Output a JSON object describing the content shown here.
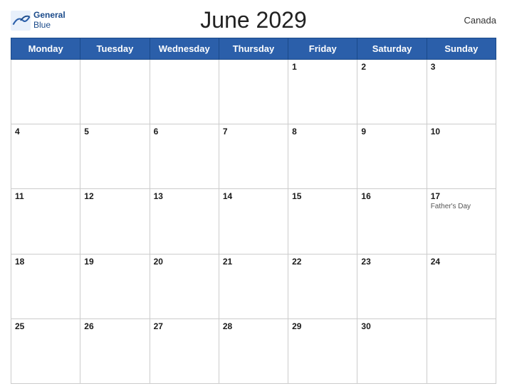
{
  "header": {
    "title": "June 2029",
    "country": "Canada",
    "logo": {
      "line1": "General",
      "line2": "Blue"
    }
  },
  "days_of_week": [
    "Monday",
    "Tuesday",
    "Wednesday",
    "Thursday",
    "Friday",
    "Saturday",
    "Sunday"
  ],
  "weeks": [
    [
      {
        "num": "",
        "holiday": ""
      },
      {
        "num": "",
        "holiday": ""
      },
      {
        "num": "",
        "holiday": ""
      },
      {
        "num": "",
        "holiday": ""
      },
      {
        "num": "1",
        "holiday": ""
      },
      {
        "num": "2",
        "holiday": ""
      },
      {
        "num": "3",
        "holiday": ""
      }
    ],
    [
      {
        "num": "4",
        "holiday": ""
      },
      {
        "num": "5",
        "holiday": ""
      },
      {
        "num": "6",
        "holiday": ""
      },
      {
        "num": "7",
        "holiday": ""
      },
      {
        "num": "8",
        "holiday": ""
      },
      {
        "num": "9",
        "holiday": ""
      },
      {
        "num": "10",
        "holiday": ""
      }
    ],
    [
      {
        "num": "11",
        "holiday": ""
      },
      {
        "num": "12",
        "holiday": ""
      },
      {
        "num": "13",
        "holiday": ""
      },
      {
        "num": "14",
        "holiday": ""
      },
      {
        "num": "15",
        "holiday": ""
      },
      {
        "num": "16",
        "holiday": ""
      },
      {
        "num": "17",
        "holiday": "Father's Day"
      }
    ],
    [
      {
        "num": "18",
        "holiday": ""
      },
      {
        "num": "19",
        "holiday": ""
      },
      {
        "num": "20",
        "holiday": ""
      },
      {
        "num": "21",
        "holiday": ""
      },
      {
        "num": "22",
        "holiday": ""
      },
      {
        "num": "23",
        "holiday": ""
      },
      {
        "num": "24",
        "holiday": ""
      }
    ],
    [
      {
        "num": "25",
        "holiday": ""
      },
      {
        "num": "26",
        "holiday": ""
      },
      {
        "num": "27",
        "holiday": ""
      },
      {
        "num": "28",
        "holiday": ""
      },
      {
        "num": "29",
        "holiday": ""
      },
      {
        "num": "30",
        "holiday": ""
      },
      {
        "num": "",
        "holiday": ""
      }
    ]
  ],
  "colors": {
    "header_bg": "#2b5faa",
    "header_text": "#ffffff",
    "border": "#1a4a8a",
    "title": "#222222",
    "logo_color": "#1a4a8a"
  }
}
